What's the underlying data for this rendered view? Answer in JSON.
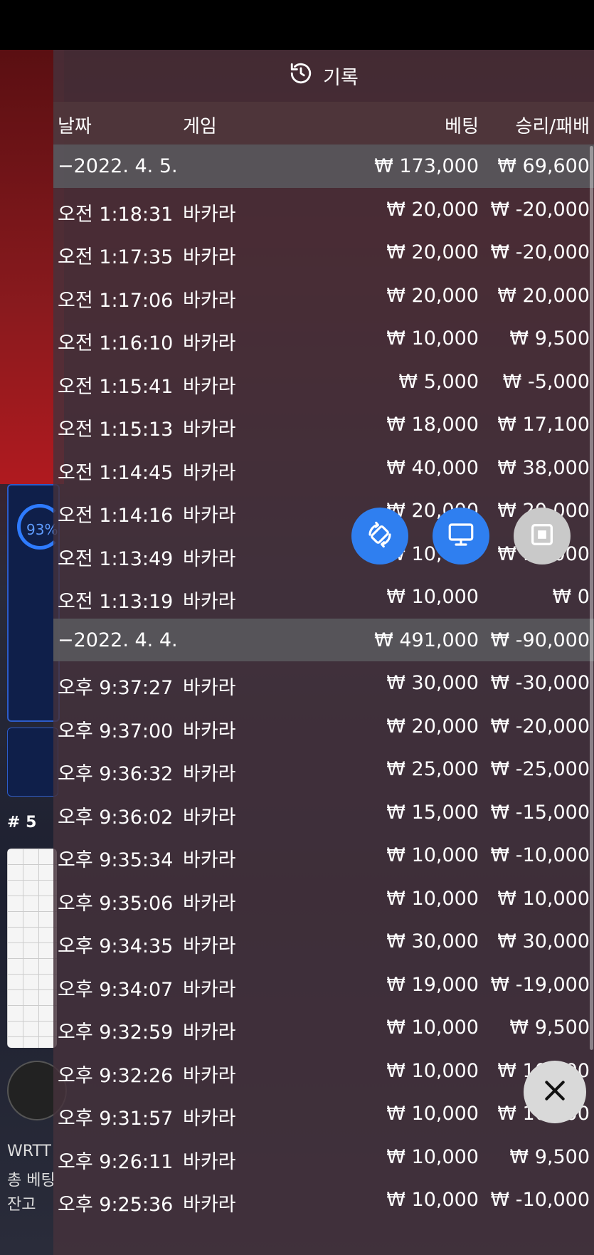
{
  "header": {
    "title": "기록"
  },
  "columns": {
    "date": "날짜",
    "game": "게임",
    "bet": "베팅",
    "winloss": "승리/패배"
  },
  "rows": [
    {
      "type": "group",
      "date": "−2022. 4. 5.",
      "game": "",
      "bet": "₩ 173,000",
      "winloss": "₩ 69,600"
    },
    {
      "type": "item",
      "date": "오전 1:18:31",
      "game": "바카라",
      "bet": "₩ 20,000",
      "winloss": "₩ -20,000"
    },
    {
      "type": "item",
      "date": "오전 1:17:35",
      "game": "바카라",
      "bet": "₩ 20,000",
      "winloss": "₩ -20,000"
    },
    {
      "type": "item",
      "date": "오전 1:17:06",
      "game": "바카라",
      "bet": "₩ 20,000",
      "winloss": "₩ 20,000"
    },
    {
      "type": "item",
      "date": "오전 1:16:10",
      "game": "바카라",
      "bet": "₩ 10,000",
      "winloss": "₩ 9,500"
    },
    {
      "type": "item",
      "date": "오전 1:15:41",
      "game": "바카라",
      "bet": "₩ 5,000",
      "winloss": "₩ -5,000"
    },
    {
      "type": "item",
      "date": "오전 1:15:13",
      "game": "바카라",
      "bet": "₩ 18,000",
      "winloss": "₩ 17,100"
    },
    {
      "type": "item",
      "date": "오전 1:14:45",
      "game": "바카라",
      "bet": "₩ 40,000",
      "winloss": "₩ 38,000"
    },
    {
      "type": "item",
      "date": "오전 1:14:16",
      "game": "바카라",
      "bet": "₩ 20,000",
      "winloss": "₩ 20,000"
    },
    {
      "type": "item",
      "date": "오전 1:13:49",
      "game": "바카라",
      "bet": "₩ 10,000",
      "winloss": "₩ 10,000"
    },
    {
      "type": "item",
      "date": "오전 1:13:19",
      "game": "바카라",
      "bet": "₩ 10,000",
      "winloss": "₩ 0"
    },
    {
      "type": "group",
      "date": "−2022. 4. 4.",
      "game": "",
      "bet": "₩ 491,000",
      "winloss": "₩ -90,000"
    },
    {
      "type": "item",
      "date": "오후 9:37:27",
      "game": "바카라",
      "bet": "₩ 30,000",
      "winloss": "₩ -30,000"
    },
    {
      "type": "item",
      "date": "오후 9:37:00",
      "game": "바카라",
      "bet": "₩ 20,000",
      "winloss": "₩ -20,000"
    },
    {
      "type": "item",
      "date": "오후 9:36:32",
      "game": "바카라",
      "bet": "₩ 25,000",
      "winloss": "₩ -25,000"
    },
    {
      "type": "item",
      "date": "오후 9:36:02",
      "game": "바카라",
      "bet": "₩ 15,000",
      "winloss": "₩ -15,000"
    },
    {
      "type": "item",
      "date": "오후 9:35:34",
      "game": "바카라",
      "bet": "₩ 10,000",
      "winloss": "₩ -10,000"
    },
    {
      "type": "item",
      "date": "오후 9:35:06",
      "game": "바카라",
      "bet": "₩ 10,000",
      "winloss": "₩ 10,000"
    },
    {
      "type": "item",
      "date": "오후 9:34:35",
      "game": "바카라",
      "bet": "₩ 30,000",
      "winloss": "₩ 30,000"
    },
    {
      "type": "item",
      "date": "오후 9:34:07",
      "game": "바카라",
      "bet": "₩ 19,000",
      "winloss": "₩ -19,000"
    },
    {
      "type": "item",
      "date": "오후 9:32:59",
      "game": "바카라",
      "bet": "₩ 10,000",
      "winloss": "₩ 9,500"
    },
    {
      "type": "item",
      "date": "오후 9:32:26",
      "game": "바카라",
      "bet": "₩ 10,000",
      "winloss": "₩ 10,000"
    },
    {
      "type": "item",
      "date": "오후 9:31:57",
      "game": "바카라",
      "bet": "₩ 10,000",
      "winloss": "₩ 10,000"
    },
    {
      "type": "item",
      "date": "오후 9:26:11",
      "game": "바카라",
      "bet": "₩ 10,000",
      "winloss": "₩ 9,500"
    },
    {
      "type": "item",
      "date": "오후 9:25:36",
      "game": "바카라",
      "bet": "₩ 10,000",
      "winloss": "₩ -10,000"
    }
  ],
  "background": {
    "progress_label": "93%",
    "round_label": "# 5",
    "user_line": "WRTT",
    "total_bet_label": "총 베팅",
    "balance_label": "잔고"
  },
  "icons": {
    "history": "history-icon",
    "rotate": "rotate-icon",
    "monitor": "monitor-icon",
    "fullscreen": "fullscreen-icon",
    "close": "close-icon"
  },
  "colors": {
    "accent": "#2f7ff0",
    "panel": "#46323c"
  }
}
